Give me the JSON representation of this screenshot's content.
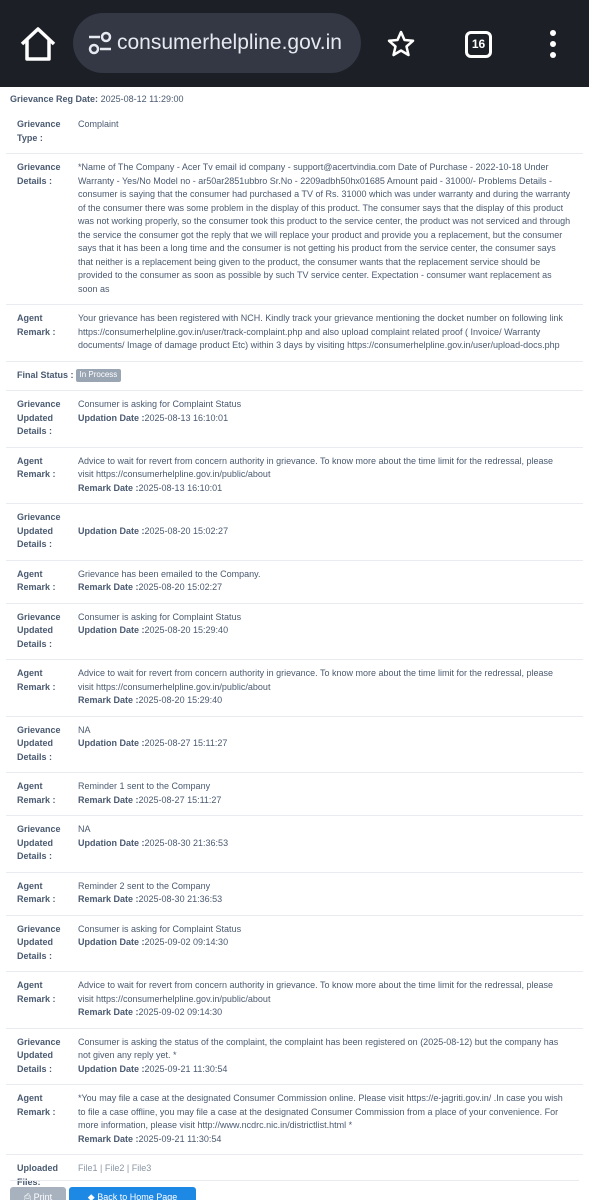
{
  "browser": {
    "url": "consumerhelpline.gov.in",
    "tab_count": "16",
    "icons": [
      "home-icon",
      "tune-icon",
      "star-icon",
      "tabs-icon",
      "more-vert-icon"
    ]
  },
  "grievance": {
    "reg_date_label": "Grievance Reg Date:",
    "reg_date": "2025-08-12 11:29:00",
    "type_label": "Grievance Type :",
    "type": "Complaint",
    "details_label": "Grievance Details :",
    "details": "*Name of The Company - Acer Tv email id company - support@acertvindia.com Date of Purchase - 2022-10-18 Under Warranty - Yes/No Model no - ar50ar2851ubbro Sr.No - 2209adbh50hx01685 Amount paid - 31000/- Problems Details - consumer is saying that the consumer had purchased a TV of Rs. 31000 which was under warranty and during the warranty of the consumer there was some problem in the display of this product. The consumer says that the display of this product was not working properly, so the consumer took this product to the service center, the product was not serviced and through the service the consumer got the reply that we will replace your product and provide you a replacement, but the consumer says that it has been a long time and the consumer is not getting his product from the service center, the consumer says that neither is a replacement being given to the product, the consumer wants that the replacement service should be provided to the consumer as soon as possible by such TV service center. Expectation - consumer want replacement as soon as",
    "agent_remark_label": "Agent Remark :",
    "agent_remark": "Your grievance has been registered with NCH. Kindly track your grievance mentioning the docket number on following link https://consumerhelpline.gov.in/user/track-complaint.php and also upload complaint related proof ( Invoice/ Warranty documents/ Image of damage product Etc) within 3 days by visiting https://consumerhelpline.gov.in/user/upload-docs.php",
    "final_status_label": "Final Status :",
    "final_status": "In Process"
  },
  "labels": {
    "updated": "Grievance Updated Details :",
    "agent": "Agent Remark :",
    "updation_date": "Updation Date :",
    "remark_date": "Remark Date :"
  },
  "updates": [
    {
      "text": "Consumer is asking for Complaint Status",
      "date": "2025-08-13 16:10:01"
    },
    {
      "text": "Advice to wait for revert from concern authority in grievance. To know more about the time limit for the redressal, please visit https://consumerhelpline.gov.in/public/about",
      "date": "2025-08-13 16:10:01"
    },
    {
      "text": "",
      "date": "2025-08-20 15:02:27"
    },
    {
      "text": "Grievance has been emailed to the Company.",
      "date": "2025-08-20 15:02:27"
    },
    {
      "text": "Consumer is asking for Complaint Status",
      "date": "2025-08-20 15:29:40"
    },
    {
      "text": "Advice to wait for revert from concern authority in grievance. To know more about the time limit for the redressal, please visit https://consumerhelpline.gov.in/public/about",
      "date": "2025-08-20 15:29:40"
    },
    {
      "text": "NA",
      "date": "2025-08-27 15:11:27"
    },
    {
      "text": "Reminder 1 sent to the Company",
      "date": "2025-08-27 15:11:27"
    },
    {
      "text": "NA",
      "date": "2025-08-30 21:36:53"
    },
    {
      "text": "Reminder 2 sent to the Company",
      "date": "2025-08-30 21:36:53"
    },
    {
      "text": "Consumer is asking for Complaint Status",
      "date": "2025-09-02 09:14:30"
    },
    {
      "text": "Advice to wait for revert from concern authority in grievance. To know more about the time limit for the redressal, please visit https://consumerhelpline.gov.in/public/about",
      "date": "2025-09-02 09:14:30"
    },
    {
      "text": "Consumer is asking the status of the complaint, the complaint has been registered on (2025-08-12) but the company has not given any reply yet. *",
      "date": "2025-09-21 11:30:54"
    },
    {
      "text": "*You may file a case at the designated Consumer Commission online. Please visit https://e-jagriti.gov.in/ .In case you wish to file a case offline, you may file a case at the designated Consumer Commission from a place of your convenience. For more information, please visit http://www.ncdrc.nic.in/districtlist.html *",
      "date": "2025-09-21 11:30:54"
    }
  ],
  "uploads": {
    "label": "Uploaded Files:",
    "files": [
      "File1",
      "File2",
      "File3"
    ],
    "separator": "|"
  },
  "buttons": {
    "print": "Print",
    "home": "Back to Home Page"
  }
}
